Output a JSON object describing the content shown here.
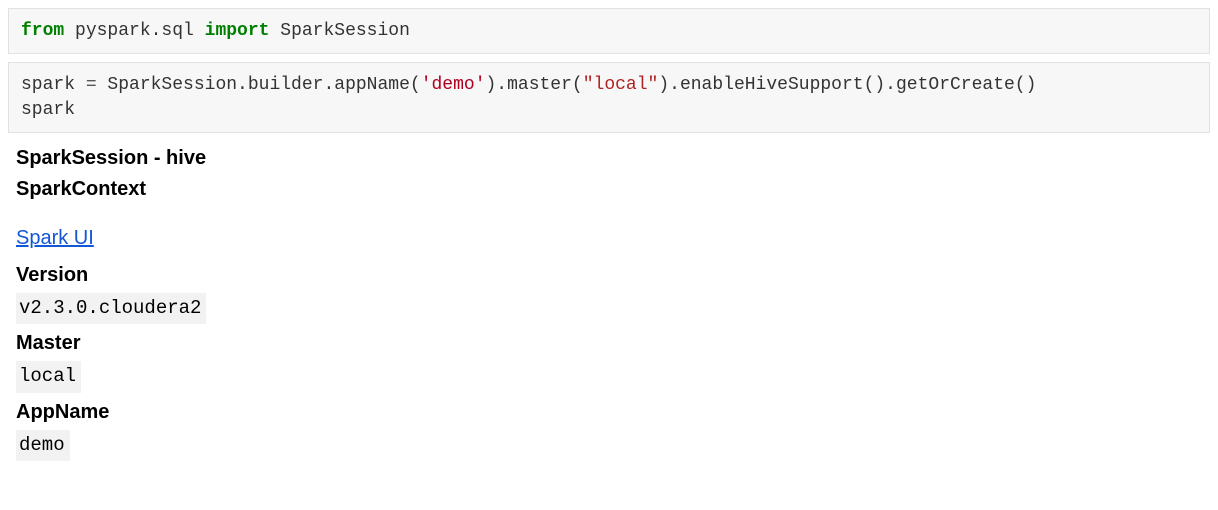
{
  "cells": {
    "c1": {
      "tokens": {
        "from": "from",
        "mod": " pyspark.sql ",
        "import": "import",
        "name": " SparkSession"
      }
    },
    "c2": {
      "tokens": {
        "l1_a": "spark ",
        "l1_eq": "=",
        "l1_b": " SparkSession.builder.appName(",
        "l1_s1": "'demo'",
        "l1_c": ").master(",
        "l1_s2": "\"local\"",
        "l1_d": ").enableHiveSupport().getOrCreate()",
        "l2": "spark"
      }
    }
  },
  "output": {
    "heading1": "SparkSession - hive",
    "heading2": "SparkContext",
    "link": "Spark UI",
    "labels": {
      "version": "Version",
      "master": "Master",
      "appname": "AppName"
    },
    "values": {
      "version": "v2.3.0.cloudera2",
      "master": "local",
      "appname": "demo"
    }
  }
}
